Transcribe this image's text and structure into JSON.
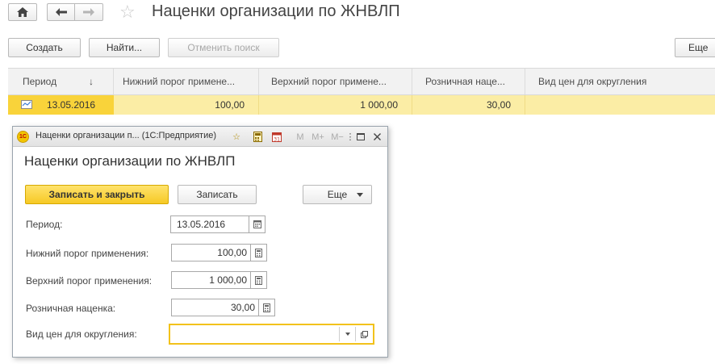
{
  "window": {
    "title": "Наценки организации по ЖНВЛП"
  },
  "toolbar": {
    "create_label": "Создать",
    "find_label": "Найти...",
    "cancel_search_label": "Отменить поиск",
    "more_label": "Еще"
  },
  "table": {
    "columns": [
      "Период",
      "Нижний порог примене...",
      "Верхний порог примене...",
      "Розничная наце...",
      "Вид цен для округления"
    ],
    "sort_indicator": "↓",
    "rows": [
      {
        "period": "13.05.2016",
        "lower": "100,00",
        "upper": "1 000,00",
        "markup": "30,00",
        "price_type": ""
      }
    ]
  },
  "dialog": {
    "caption": "Наценки организации п... (1С:Предприятие)",
    "app_badge": "1С",
    "tb_m": "M",
    "tb_mplus": "M+",
    "tb_mminus": "M−",
    "title": "Наценки организации по ЖНВЛП",
    "save_close_label": "Записать и закрыть",
    "save_label": "Записать",
    "more_label": "Еще",
    "fields": {
      "period_label": "Период:",
      "period_value": "13.05.2016",
      "lower_label": "Нижний порог применения:",
      "lower_value": "100,00",
      "upper_label": "Верхний порог применения:",
      "upper_value": "1 000,00",
      "markup_label": "Розничная наценка:",
      "markup_value": "30,00",
      "price_type_label": "Вид цен для округления:",
      "price_type_value": ""
    }
  },
  "colors": {
    "accent_yellow": "#f9d33a",
    "row_highlight": "#fbeda5"
  }
}
